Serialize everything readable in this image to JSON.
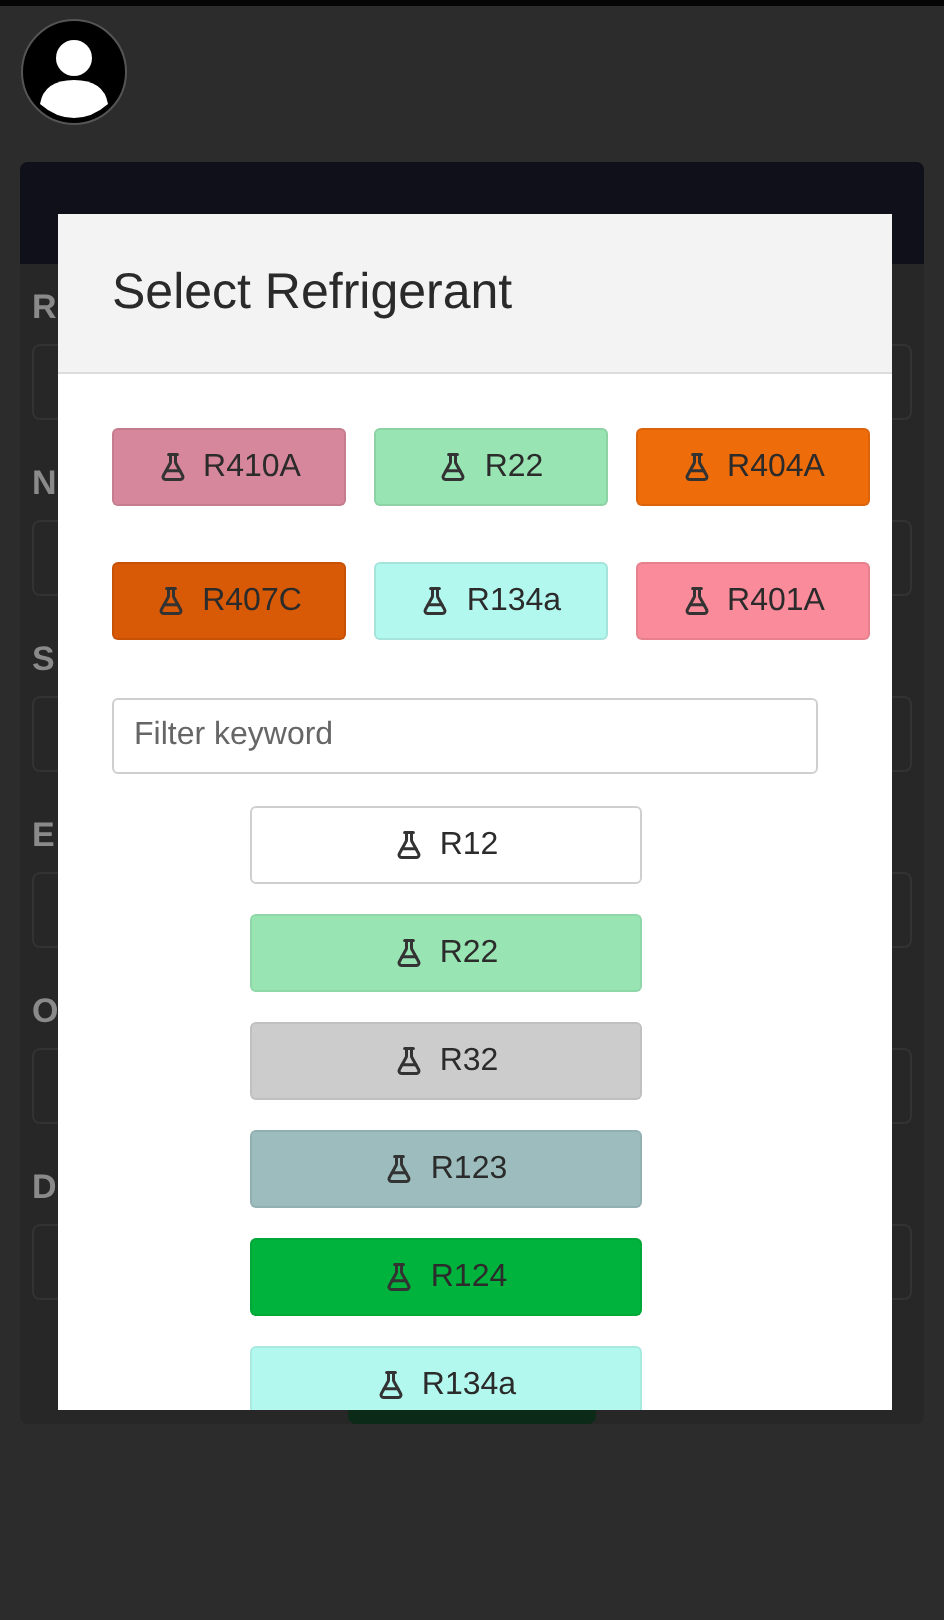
{
  "background": {
    "fields": [
      {
        "label": "R"
      },
      {
        "label": "N"
      },
      {
        "label": "S"
      },
      {
        "label": "E"
      },
      {
        "label": "O"
      },
      {
        "label": "D"
      }
    ]
  },
  "dialog": {
    "title": "Select Refrigerant",
    "favorites": [
      {
        "label": "R410A",
        "color": "#d6879b"
      },
      {
        "label": "R22",
        "color": "#98e4b3"
      },
      {
        "label": "R404A",
        "color": "#ef6c0a"
      },
      {
        "label": "R407C",
        "color": "#d85a06"
      },
      {
        "label": "R134a",
        "color": "#b3f8ee"
      },
      {
        "label": "R401A",
        "color": "#fa8b9a"
      }
    ],
    "filter": {
      "placeholder": "Filter keyword"
    },
    "refrigerants": [
      {
        "label": "R12",
        "color": "#ffffff"
      },
      {
        "label": "R22",
        "color": "#98e4b3"
      },
      {
        "label": "R32",
        "color": "#cccccc"
      },
      {
        "label": "R123",
        "color": "#9cbcbd"
      },
      {
        "label": "R124",
        "color": "#00b33c"
      },
      {
        "label": "R134a",
        "color": "#b3f8ee"
      }
    ]
  }
}
